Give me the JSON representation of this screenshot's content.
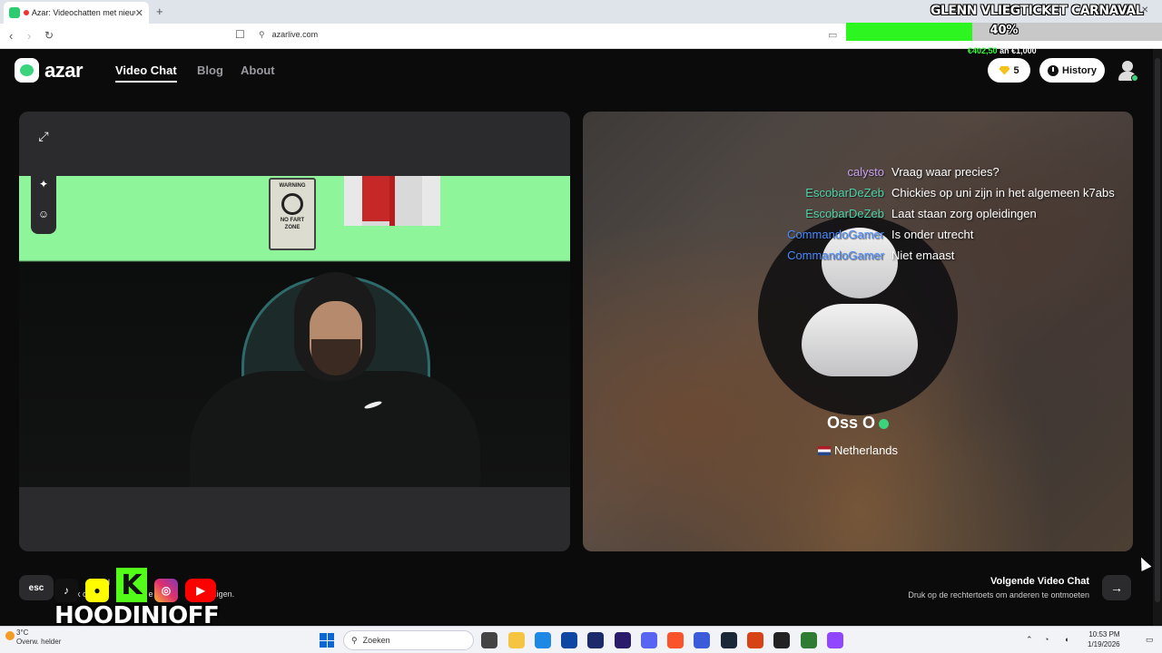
{
  "browser": {
    "tab_title": "Azar: Videochatten met nieuw",
    "url": "azarlive.com"
  },
  "overlay": {
    "goal_title": "GLENN VLIEGTICKET CARNAVAL",
    "goal_percent": "40%",
    "goal_progress": 0.4,
    "goal_amount": "€402,50",
    "goal_amount_sep": "an",
    "goal_target": "€1,000"
  },
  "site": {
    "logo": "azar",
    "nav": [
      "Video Chat",
      "Blog",
      "About"
    ],
    "gems": "5",
    "history": "History"
  },
  "partner": {
    "name": "Oss O",
    "country": "Netherlands"
  },
  "chat": [
    {
      "user": "calysto",
      "color": "#c8a2f0",
      "message": "Vraag waar precies?"
    },
    {
      "user": "EscobarDeZeb",
      "color": "#4fd3a8",
      "message": "Chickies op uni zijn in het algemeen k7abs"
    },
    {
      "user": "EscobarDeZeb",
      "color": "#4fd3a8",
      "message": "Laat staan zorg opleidingen"
    },
    {
      "user": "CommandoGamer",
      "color": "#4a8cff",
      "message": "Is onder utrecht"
    },
    {
      "user": "CommandoGamer",
      "color": "#4a8cff",
      "message": "Niet emaast"
    }
  ],
  "webcam": {
    "sign_line1": "WARNING",
    "sign_line2": "NO FART",
    "sign_line3": "ZONE"
  },
  "footer": {
    "esc": "esc",
    "hint_line1": "Be",
    "hint_line1_b": "ind",
    "hint_line2": "k op",
    "hint_line2_b": "e",
    "hint_line2_c": "spre",
    "hint_line2_d": "ndigen.",
    "handle": "HOODINIOFF",
    "next_title": "Volgende Video Chat",
    "next_sub": "Druk op de rechtertoets om anderen te ontmoeten"
  },
  "taskbar": {
    "temp": "3°C",
    "weather": "Overw. helder",
    "search": "Zoeken",
    "time": "10:53 PM",
    "date": "1/19/2026"
  }
}
